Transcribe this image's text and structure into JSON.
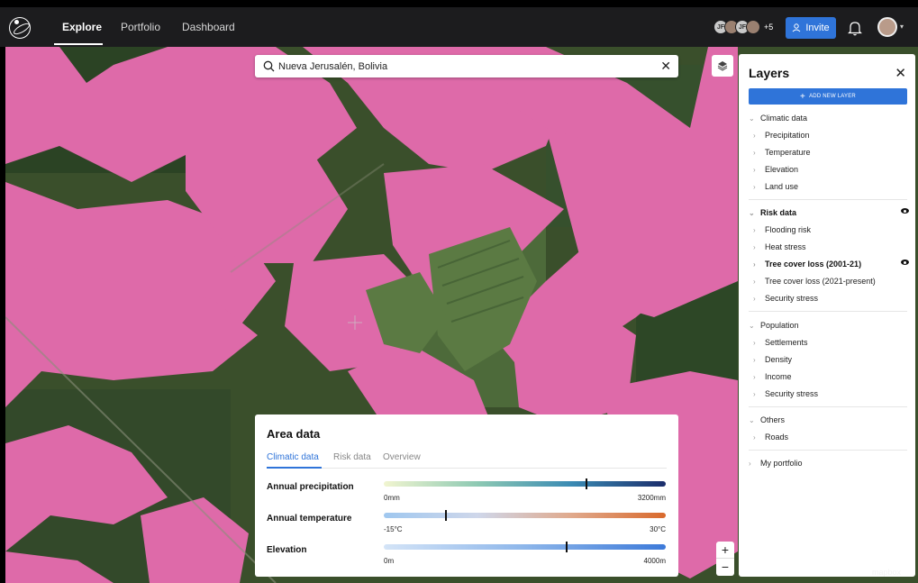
{
  "nav": {
    "links": [
      {
        "label": "Explore"
      },
      {
        "label": "Portfolio"
      },
      {
        "label": "Dashboard"
      }
    ],
    "avatars": [
      "JF",
      "JF"
    ],
    "avatar_more": "+5",
    "invite_label": "Invite"
  },
  "search": {
    "value": "Nueva Jerusalén, Bolivia",
    "clear": "✕"
  },
  "layers": {
    "title": "Layers",
    "close": "✕",
    "add_label": "ADD NEW LAYER",
    "groups": [
      {
        "label": "Climatic data",
        "items": [
          "Precipitation",
          "Temperature",
          "Elevation",
          "Land use"
        ]
      },
      {
        "label": "Risk data",
        "items": [
          "Flooding risk",
          "Heat stress",
          "Tree cover loss (2001-21)",
          "Tree cover loss (2021-present)",
          "Security stress"
        ]
      },
      {
        "label": "Population",
        "items": [
          "Settlements",
          "Density",
          "Income",
          "Security stress"
        ]
      },
      {
        "label": "Others",
        "items": [
          "Roads"
        ]
      },
      {
        "label": "My portfolio",
        "items": []
      }
    ]
  },
  "area": {
    "title": "Area data",
    "tabs": [
      "Climatic data",
      "Risk data",
      "Overview"
    ],
    "metrics": [
      {
        "label": "Annual precipitation",
        "min": "0mm",
        "max": "3200mm",
        "value_fraction": 0.72
      },
      {
        "label": "Annual temperature",
        "min": "-15°C",
        "max": "30°C",
        "value_fraction": 0.22
      },
      {
        "label": "Elevation",
        "min": "0m",
        "max": "4000m",
        "value_fraction": 0.65
      }
    ]
  },
  "zoom": {
    "in": "+",
    "out": "−"
  },
  "colors": {
    "accent": "#2f74d9",
    "overlay": "#de6aa9",
    "forest": "#2d4a25",
    "nav_bg": "#1c1c1e"
  },
  "attribution": "mapbox"
}
